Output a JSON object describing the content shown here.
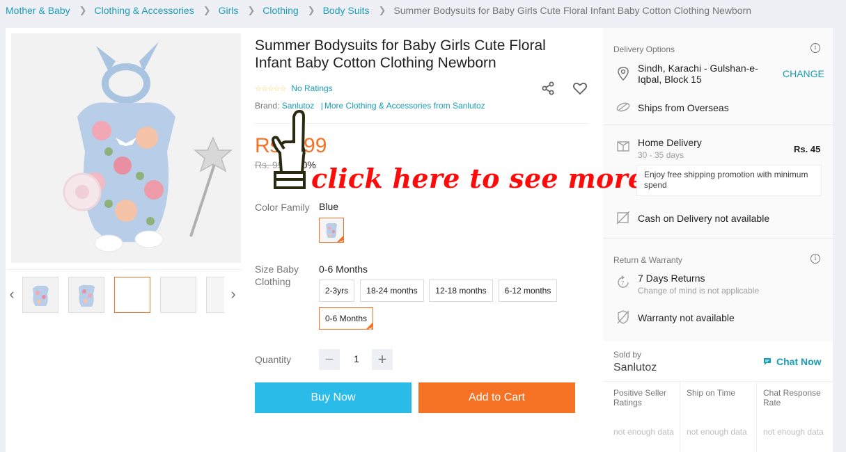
{
  "breadcrumb": {
    "items": [
      "Mother & Baby",
      "Clothing & Accessories",
      "Girls",
      "Clothing",
      "Body Suits"
    ],
    "current": "Summer Bodysuits for Baby Girls Cute Floral Infant Baby Cotton Clothing Newborn"
  },
  "product": {
    "title": "Summer Bodysuits for Baby Girls Cute Floral Infant Baby Cotton Clothing Newborn",
    "rating_text": "No Ratings",
    "brand_label": "Brand:",
    "brand_name": "Sanlutoz",
    "brand_more": "More Clothing & Accessories from Sanlutoz",
    "price": "Rs. 699",
    "original_price": "Rs. 999",
    "discount": "-30%",
    "overlay_text": "click here to see more products!",
    "color_label": "Color Family",
    "color_value": "Blue",
    "size_label": "Size Baby Clothing",
    "size_value": "0-6 Months",
    "sizes": [
      "2-3yrs",
      "18-24 months",
      "12-18 months",
      "6-12 months",
      "0-6 Months"
    ],
    "selected_size": "0-6 Months",
    "quantity_label": "Quantity",
    "quantity": "1",
    "buy_now": "Buy Now",
    "add_to_cart": "Add to Cart"
  },
  "delivery": {
    "header": "Delivery Options",
    "location": "Sindh, Karachi - Gulshan-e-Iqbal, Block 15",
    "change": "CHANGE",
    "ships_from": "Ships from Overseas",
    "home_delivery": "Home Delivery",
    "home_delivery_time": "30 - 35 days",
    "home_delivery_fee": "Rs. 45",
    "promo": "Enjoy free shipping promotion with minimum spend",
    "cod": "Cash on Delivery not available"
  },
  "warranty": {
    "header": "Return & Warranty",
    "returns": "7 Days Returns",
    "returns_sub": "Change of mind is not applicable",
    "warranty": "Warranty not available"
  },
  "seller": {
    "sold_by": "Sold by",
    "name": "Sanlutoz",
    "chat": "Chat Now",
    "metrics": [
      {
        "label": "Positive Seller Ratings",
        "value": "not enough data"
      },
      {
        "label": "Ship on Time",
        "value": "not enough data"
      },
      {
        "label": "Chat Response Rate",
        "value": "not enough data"
      }
    ]
  },
  "colors": {
    "accent_orange": "#f57224",
    "link_blue": "#1a9cb7",
    "buy_blue": "#2abbe8",
    "overlay_red": "#ff0a0a"
  }
}
